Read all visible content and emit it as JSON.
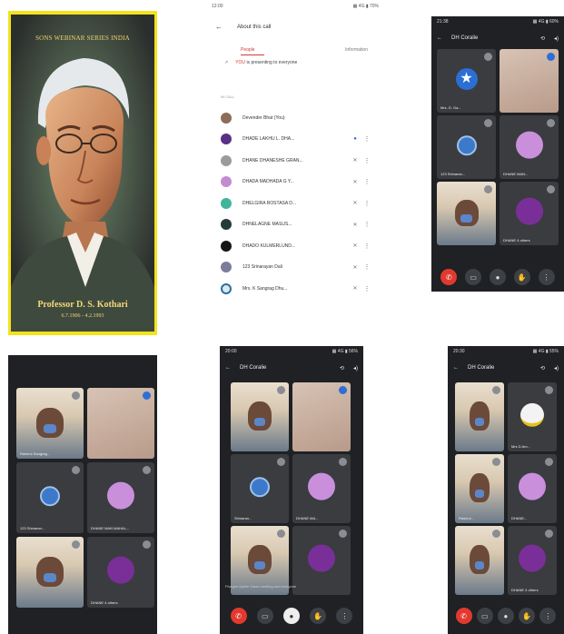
{
  "panel1": {
    "title": "SONS WEBINAR SERIES INDIA",
    "caption": "Professor D. S. Kothari",
    "dates": "6.7.1906 - 4.2.1993"
  },
  "panel2": {
    "status_time": "12:00",
    "status_icons": "▦ 4G ▮ 70%",
    "about_title": "About this call",
    "tab_people": "People",
    "tab_info": "Information",
    "presenting_name": "YOU",
    "presenting_text": "is presenting to everyone",
    "section_label": "IN CALL",
    "participants": [
      {
        "name": "Devender Bhat (You)",
        "color": "#8b6d58",
        "mic": "",
        "more": ""
      },
      {
        "name": "DHADE LAKHU L. DHA...",
        "color": "#5a2f86",
        "mic": "●",
        "more": "⋮"
      },
      {
        "name": "DHANE DHANESHE GRAN...",
        "color": "#9b9b9b",
        "mic": "✕",
        "more": "⋮"
      },
      {
        "name": "DHADA MADHADA G Y...",
        "color": "#c58bd2",
        "mic": "✕",
        "more": "⋮"
      },
      {
        "name": "DHELGIRA ROSTASA D...",
        "color": "#41b59a",
        "mic": "✕",
        "more": "⋮"
      },
      {
        "name": "DHNELAGNE MASUS...",
        "color": "#263a3a",
        "mic": "✕",
        "more": "⋮"
      },
      {
        "name": "DHADO KULMERLUND...",
        "color": "#161616",
        "mic": "✕",
        "more": "⋮"
      },
      {
        "name": "123 Srinarayan Dali",
        "color": "#7c7d9c",
        "mic": "✕",
        "more": "⋮"
      },
      {
        "name": "Mrs. K Sangrag Dhu...",
        "color": "#dbe8f0",
        "mic": "✕",
        "more": "⋮"
      }
    ]
  },
  "panel3": {
    "time": "21:38",
    "status": "▦ 4G ▮ 60%",
    "meeting_code": "DH Coralie",
    "tiles": [
      {
        "label": "Mrs. D. Ga...",
        "kind": "star"
      },
      {
        "label": "",
        "kind": "wall"
      },
      {
        "label": "123 Shinaran...",
        "kind": "avatar"
      },
      {
        "label": "DHANE MAN...",
        "kind": "purple"
      },
      {
        "label": "",
        "kind": "person"
      },
      {
        "label": "DHANE 4 others",
        "kind": "purple-dark"
      }
    ]
  },
  "panel4": {
    "tiles": [
      {
        "label": "Rashmi Sangrag...",
        "kind": "person"
      },
      {
        "label": "",
        "kind": "wall"
      },
      {
        "label": "123 Shinaran...",
        "kind": "avatar"
      },
      {
        "label": "DHANE MAN MAHAL...",
        "kind": "purple"
      },
      {
        "label": "",
        "kind": "person"
      },
      {
        "label": "DHANE 4 others",
        "kind": "purple-dark"
      }
    ]
  },
  "panel5": {
    "time": "20:00",
    "status": "▦ 4G ▮ 56%",
    "meeting_code": "DH Coralie",
    "tiles": [
      {
        "label": "",
        "kind": "person"
      },
      {
        "label": "",
        "kind": "wall"
      },
      {
        "label": "Shinaran...",
        "kind": "avatar"
      },
      {
        "label": "DHANE MA...",
        "kind": "purple"
      },
      {
        "label": "",
        "kind": "person"
      },
      {
        "label": "",
        "kind": "purple-dark"
      }
    ],
    "presenter_text": "Fivegen Apelle Class meeting and everyone"
  },
  "panel6": {
    "time": "20:30",
    "status": "▦ 4G ▮ 55%",
    "meeting_code": "DH Coralie",
    "tiles": [
      {
        "label": "",
        "kind": "person"
      },
      {
        "label": "Mrs D Am...",
        "kind": "logo"
      },
      {
        "label": "Rashmi...",
        "kind": "person"
      },
      {
        "label": "DHANE...",
        "kind": "purple"
      },
      {
        "label": "",
        "kind": "person"
      },
      {
        "label": "DHANE 4 others",
        "kind": "purple-dark"
      }
    ]
  },
  "colors": {
    "accent_yellow": "#f4e31b",
    "dark_bg": "#1f2124",
    "end_call_red": "#e2392f",
    "avatar_purple": "#c98fdb",
    "avatar_purple_dark": "#7a2f98"
  },
  "icons": [
    "back-arrow-icon",
    "switch-camera-icon",
    "volume-icon",
    "mic-off-icon",
    "more-icon",
    "end-call-icon",
    "camera-icon",
    "mic-icon",
    "hand-icon",
    "star-icon"
  ]
}
